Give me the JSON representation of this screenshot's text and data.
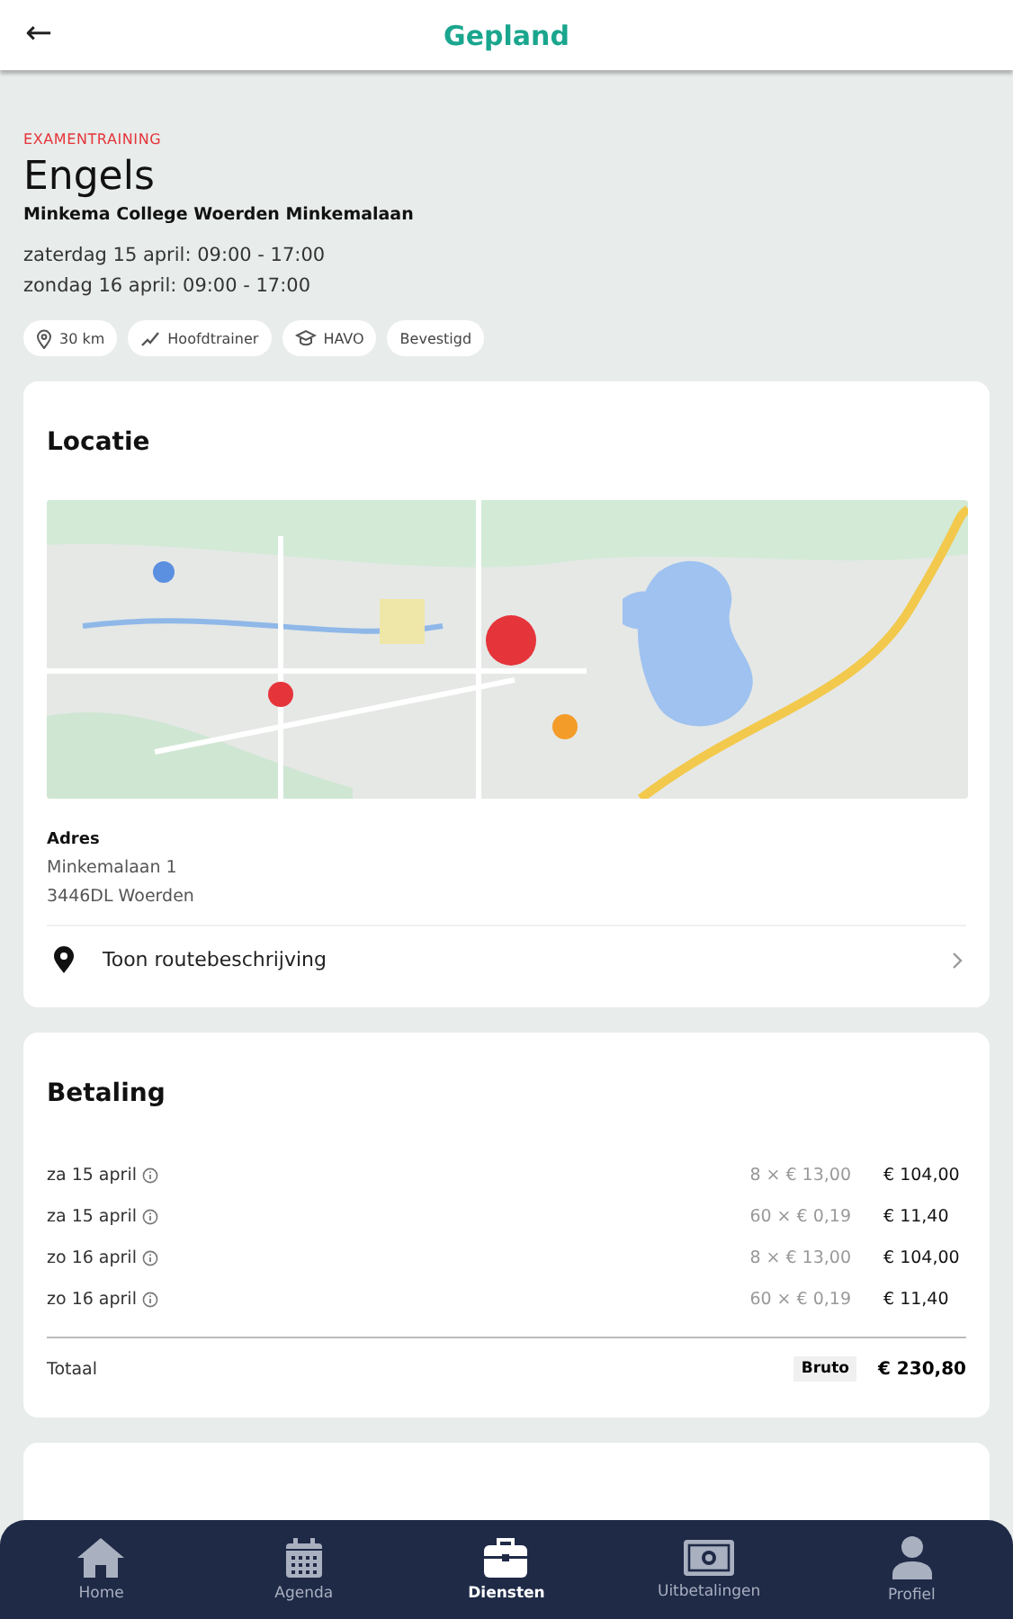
{
  "top_bar": {
    "back": "←",
    "title": "Gepland"
  },
  "event": {
    "category": "EXAMENTRAINING",
    "title": "Engels",
    "venue": "Minkema College Woerden Minkemalaan",
    "dates": [
      "zaterdag 15 april: 09:00 - 17:00",
      "zondag 16 april: 09:00 - 17:00"
    ],
    "tags": [
      {
        "kind": "distance",
        "label": "30 km"
      },
      {
        "kind": "role",
        "label": "Hoofdtrainer"
      },
      {
        "kind": "level",
        "label": "HAVO"
      },
      {
        "kind": "status",
        "label": "Bevestigd"
      }
    ]
  },
  "location": {
    "title": "Locatie",
    "address_label": "Adres",
    "address_lines": [
      "Minkemalaan 1",
      "3446DL Woerden"
    ],
    "route_link": "Toon routebeschrijving"
  },
  "payment": {
    "title": "Betaling",
    "rows": [
      {
        "date": "za 15 april",
        "quantity": "8 × € 13,00",
        "amount": "€ 104,00"
      },
      {
        "date": "za 15 april",
        "quantity": "60 × € 0,19",
        "amount": "€ 11,40"
      },
      {
        "date": "zo 16 april",
        "quantity": "8 × € 13,00",
        "amount": "€ 104,00"
      },
      {
        "date": "zo 16 april",
        "quantity": "60 × € 0,19",
        "amount": "€ 11,40"
      }
    ],
    "total_label": "Totaal",
    "total_badge": "Bruto",
    "total_amount": "€ 230,80"
  },
  "nav": [
    {
      "kind": "home",
      "label": "Home",
      "selected": false
    },
    {
      "kind": "calendar",
      "label": "Agenda",
      "selected": false
    },
    {
      "kind": "briefcase",
      "label": "Diensten",
      "selected": true
    },
    {
      "kind": "money",
      "label": "Uitbetalingen",
      "selected": false
    },
    {
      "kind": "person",
      "label": "Profiel",
      "selected": false
    }
  ]
}
